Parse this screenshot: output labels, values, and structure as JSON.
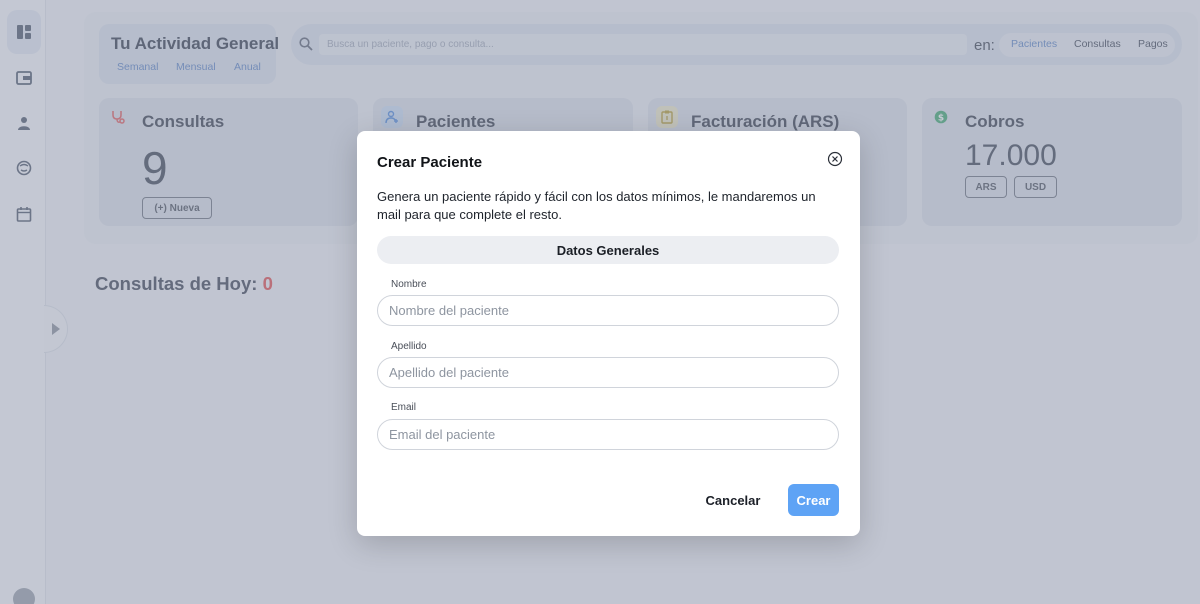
{
  "sidebar": {
    "items": [
      {
        "name": "dashboard-icon",
        "active": true
      },
      {
        "name": "wallet-icon"
      },
      {
        "name": "user-icon"
      },
      {
        "name": "tooth-icon"
      },
      {
        "name": "calendar-icon"
      }
    ]
  },
  "activity": {
    "title": "Tu Actividad General",
    "periods": [
      "Semanal",
      "Mensual",
      "Anual"
    ]
  },
  "search": {
    "placeholder": "Busca un paciente, pago o consulta...",
    "in_label": "en:",
    "scopes": [
      "Pacientes",
      "Consultas",
      "Pagos"
    ],
    "active_scope": "Pacientes"
  },
  "cards": {
    "consultas": {
      "title": "Consultas",
      "value": "9",
      "button": "(+) Nueva"
    },
    "pacientes": {
      "title": "Pacientes"
    },
    "facturacion": {
      "title": "Facturación (ARS)"
    },
    "cobros": {
      "title": "Cobros",
      "value": "17.000",
      "currencies": [
        "ARS",
        "USD"
      ]
    }
  },
  "today": {
    "label": "Consultas de Hoy:",
    "count": "0"
  },
  "modal": {
    "title": "Crear Paciente",
    "description": "Genera un paciente rápido y fácil con los datos mínimos, le mandaremos un mail para que complete el resto.",
    "section": "Datos Generales",
    "fields": [
      {
        "label": "Nombre",
        "placeholder": "Nombre del paciente",
        "value": ""
      },
      {
        "label": "Apellido",
        "placeholder": "Apellido del paciente",
        "value": ""
      },
      {
        "label": "Email",
        "placeholder": "Email del paciente",
        "value": ""
      }
    ],
    "cancel": "Cancelar",
    "submit": "Crear"
  },
  "colors": {
    "accent": "#5ea3f5",
    "link": "#5b84c6",
    "danger": "#e64a4a"
  }
}
